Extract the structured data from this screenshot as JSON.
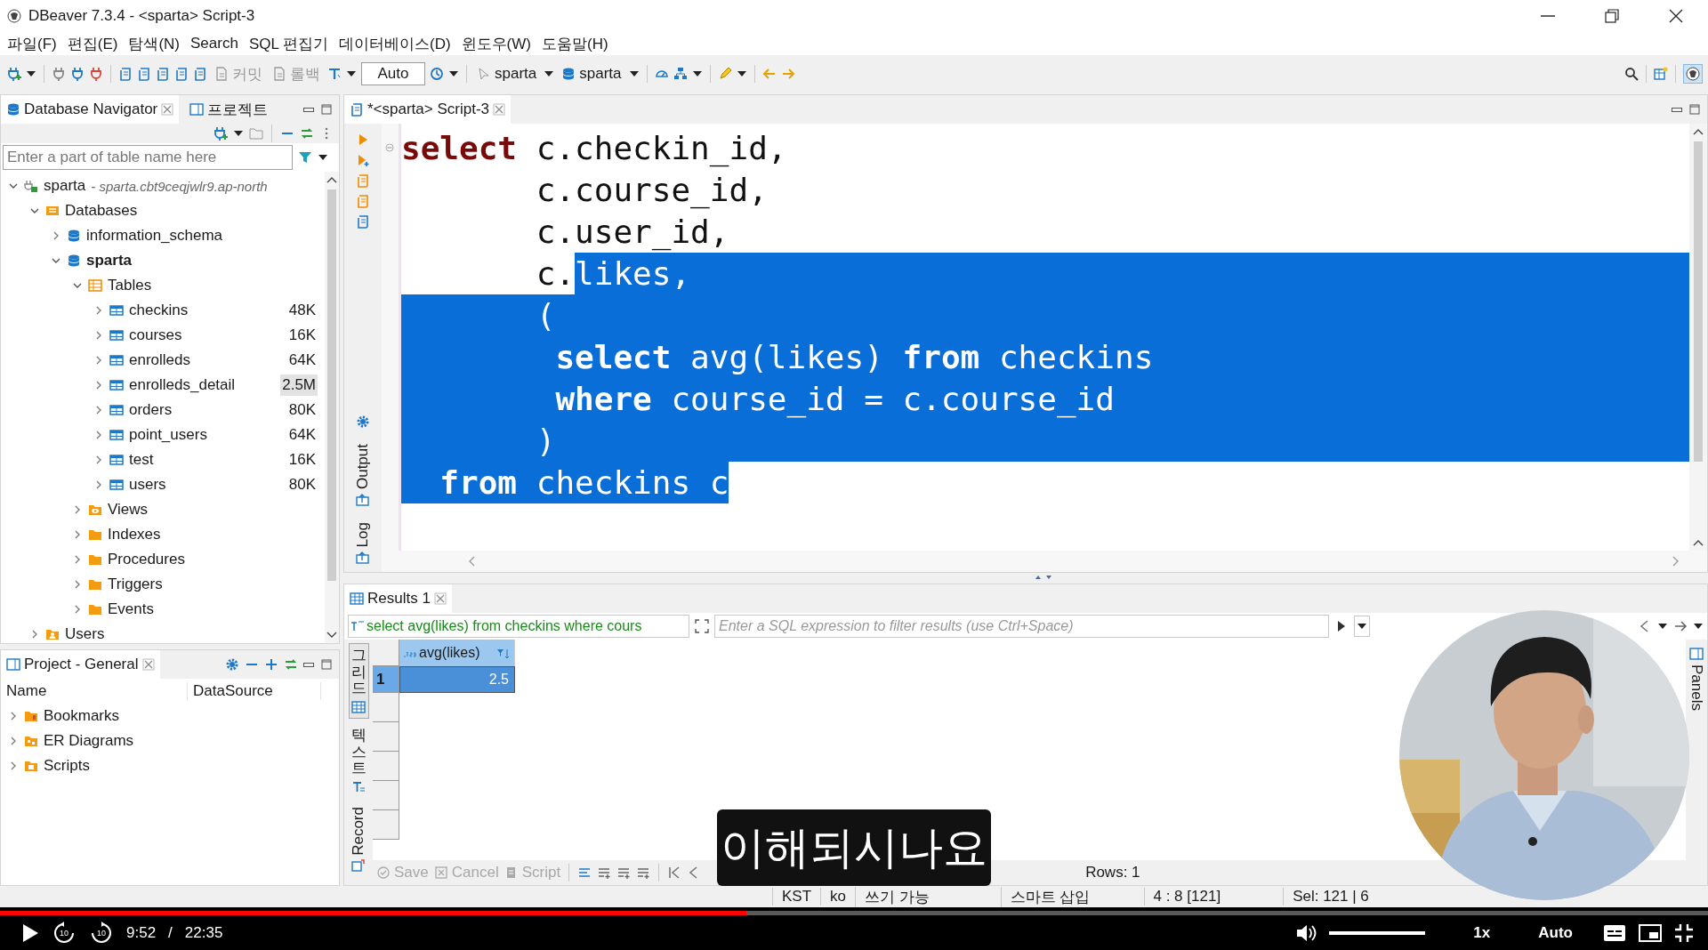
{
  "window": {
    "title": "DBeaver 7.3.4 - <sparta> Script-3"
  },
  "menu": [
    "파일(F)",
    "편집(E)",
    "탐색(N)",
    "Search",
    "SQL 편집기",
    "데이터베이스(D)",
    "윈도우(W)",
    "도움말(H)"
  ],
  "toolbar": {
    "transaction_buttons": [
      {
        "label": "커밋",
        "disabled": true
      },
      {
        "label": "롤백",
        "disabled": true
      }
    ],
    "commit_mode": "Auto",
    "datasource": "sparta",
    "schema": "sparta"
  },
  "navigator": {
    "tabs": [
      {
        "label": "Database Navigator",
        "selected": true
      },
      {
        "label": "프로젝트",
        "selected": false
      }
    ],
    "filter": {
      "placeholder": "Enter a part of table name here"
    },
    "tree": [
      {
        "label": "sparta",
        "kind": "connection",
        "detail": "- sparta.cbt9ceqjwlr9.ap-north",
        "expanded": true,
        "active": false,
        "children": [
          {
            "label": "Databases",
            "kind": "databases",
            "expanded": true,
            "active": false,
            "children": [
              {
                "label": "information_schema",
                "kind": "database",
                "expanded": false,
                "active": false
              },
              {
                "label": "sparta",
                "kind": "database",
                "expanded": true,
                "active": true,
                "children": [
                  {
                    "label": "Tables",
                    "kind": "tables",
                    "expanded": true,
                    "active": false,
                    "children": [
                      {
                        "label": "checkins",
                        "kind": "table",
                        "size": "48K",
                        "size_highlighted": false,
                        "expanded": false,
                        "active": false
                      },
                      {
                        "label": "courses",
                        "kind": "table",
                        "size": "16K",
                        "size_highlighted": false,
                        "expanded": false,
                        "active": false
                      },
                      {
                        "label": "enrolleds",
                        "kind": "table",
                        "size": "64K",
                        "size_highlighted": false,
                        "expanded": false,
                        "active": false
                      },
                      {
                        "label": "enrolleds_detail",
                        "kind": "table",
                        "size": "2.5M",
                        "size_highlighted": true,
                        "expanded": false,
                        "active": false
                      },
                      {
                        "label": "orders",
                        "kind": "table",
                        "size": "80K",
                        "size_highlighted": false,
                        "expanded": false,
                        "active": false
                      },
                      {
                        "label": "point_users",
                        "kind": "table",
                        "size": "64K",
                        "size_highlighted": false,
                        "expanded": false,
                        "active": false
                      },
                      {
                        "label": "test",
                        "kind": "table",
                        "size": "16K",
                        "size_highlighted": false,
                        "expanded": false,
                        "active": false
                      },
                      {
                        "label": "users",
                        "kind": "table",
                        "size": "80K",
                        "size_highlighted": false,
                        "expanded": false,
                        "active": false
                      }
                    ]
                  },
                  {
                    "label": "Views",
                    "kind": "views",
                    "expanded": false,
                    "active": false
                  },
                  {
                    "label": "Indexes",
                    "kind": "folder",
                    "expanded": false,
                    "active": false
                  },
                  {
                    "label": "Procedures",
                    "kind": "folder",
                    "expanded": false,
                    "active": false
                  },
                  {
                    "label": "Triggers",
                    "kind": "folder",
                    "expanded": false,
                    "active": false
                  },
                  {
                    "label": "Events",
                    "kind": "folder",
                    "expanded": false,
                    "active": false
                  }
                ]
              }
            ]
          },
          {
            "label": "Users",
            "kind": "users",
            "expanded": false,
            "active": false
          }
        ]
      }
    ]
  },
  "project": {
    "tab": {
      "label": "Project - General",
      "selected": true
    },
    "columns": [
      "Name",
      "DataSource"
    ],
    "items": [
      {
        "label": "Bookmarks",
        "kind": "bookmarks",
        "expanded": false
      },
      {
        "label": "ER Diagrams",
        "kind": "diagrams",
        "expanded": false
      },
      {
        "label": "Scripts",
        "kind": "scripts",
        "expanded": false
      }
    ]
  },
  "editor": {
    "tab": {
      "label": "*<sparta> Script-3",
      "selected": true
    },
    "side_tabs": [
      "Output",
      "Log"
    ],
    "lines": [
      {
        "tokens": [
          {
            "text": "select",
            "kind": "keyword",
            "selected": false
          },
          {
            "text": " c.checkin_id,",
            "kind": "plain",
            "selected": false
          }
        ],
        "eol_selected": false
      },
      {
        "tokens": [
          {
            "text": "       c.course_id,",
            "kind": "plain",
            "selected": false
          }
        ],
        "eol_selected": false
      },
      {
        "tokens": [
          {
            "text": "       c.user_id,",
            "kind": "plain",
            "selected": false
          }
        ],
        "eol_selected": false
      },
      {
        "tokens": [
          {
            "text": "       c.",
            "kind": "plain",
            "selected": false
          },
          {
            "text": "likes,",
            "kind": "plain",
            "selected": true
          }
        ],
        "eol_selected": true
      },
      {
        "tokens": [
          {
            "text": "       (",
            "kind": "plain",
            "selected": true
          }
        ],
        "eol_selected": true
      },
      {
        "tokens": [
          {
            "text": "        select",
            "kind": "keyword",
            "selected": true
          },
          {
            "text": " avg(likes) ",
            "kind": "plain",
            "selected": true
          },
          {
            "text": "from",
            "kind": "keyword",
            "selected": true
          },
          {
            "text": " checkins",
            "kind": "plain",
            "selected": true
          }
        ],
        "eol_selected": true
      },
      {
        "tokens": [
          {
            "text": "        where",
            "kind": "keyword",
            "selected": true
          },
          {
            "text": " course_id = c.course_id",
            "kind": "plain",
            "selected": true
          }
        ],
        "eol_selected": true
      },
      {
        "tokens": [
          {
            "text": "       )",
            "kind": "plain",
            "selected": true
          }
        ],
        "eol_selected": true
      },
      {
        "tokens": [
          {
            "text": "  from",
            "kind": "keyword",
            "selected": true
          },
          {
            "text": " checkins c",
            "kind": "plain",
            "selected": true
          }
        ],
        "eol_selected": false
      }
    ]
  },
  "results": {
    "tab": {
      "label": "Results 1",
      "selected": true
    },
    "query": "select avg(likes) from checkins where cours",
    "filter_placeholder": "Enter a SQL expression to filter results (use Ctrl+Space)",
    "view_tabs": [
      {
        "label": "그리드",
        "kind": "stacked",
        "selected": true
      },
      {
        "label": "텍스트",
        "kind": "stacked",
        "selected": false
      },
      {
        "label": "Record",
        "kind": "rotated",
        "selected": false
      }
    ],
    "columns": [
      "avg(likes)"
    ],
    "rows": [
      {
        "number": "1",
        "cells": [
          "2.5"
        ],
        "selected": true
      }
    ],
    "actions": [
      {
        "label": "Save",
        "disabled": true
      },
      {
        "label": "Cancel",
        "disabled": true
      },
      {
        "label": "Script",
        "disabled": true
      }
    ],
    "row_count": "Rows: 1",
    "panels_tab": "Panels"
  },
  "status_bar": [
    "KST",
    "ko",
    "쓰기 가능",
    "스마트 삽입",
    "4 : 8 [121]",
    "Sel: 121 | 6"
  ],
  "subtitle": "이해되시나요",
  "webcam": {
    "kind": "picture"
  },
  "player": {
    "progress": {
      "level": 0.437
    },
    "skip_back": "10",
    "skip_forward": "10",
    "current_time": "9:52",
    "separator": "/",
    "duration": "22:35",
    "volume": {
      "level": 1
    },
    "speed": "1x",
    "quality": "Auto"
  }
}
